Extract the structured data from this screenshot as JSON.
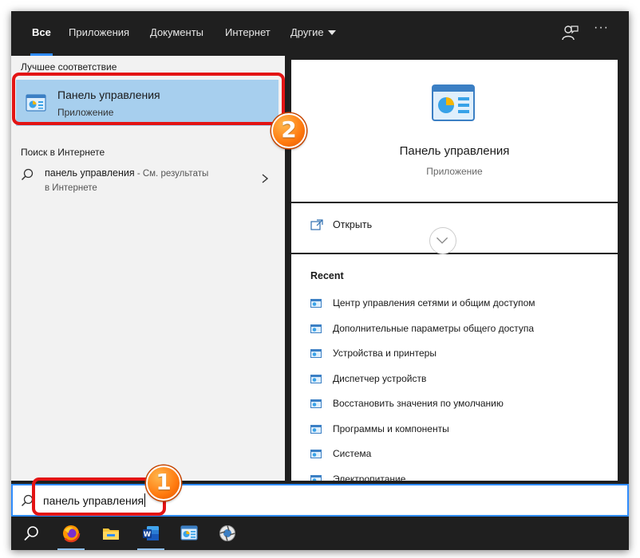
{
  "nav": {
    "tabs": [
      {
        "label": "Все",
        "active": true
      },
      {
        "label": "Приложения"
      },
      {
        "label": "Документы"
      },
      {
        "label": "Интернет"
      },
      {
        "label": "Другие"
      }
    ],
    "feedback_icon": "feedback-icon",
    "more_icon": "more-options-icon",
    "more_glyph": "···"
  },
  "best_match": {
    "heading": "Лучшее соответствие",
    "title": "Панель управления",
    "subtitle": "Приложение",
    "icon": "control-panel-icon"
  },
  "web_search": {
    "heading": "Поиск в Интернете",
    "query": "панель управления",
    "suffix": " - См. результаты",
    "suffix2": "в Интернете",
    "icon": "search-icon"
  },
  "preview": {
    "title": "Панель управления",
    "subtitle": "Приложение",
    "open_label": "Открыть"
  },
  "recent": {
    "heading": "Recent",
    "items": [
      "Центр управления сетями и общим доступом",
      "Дополнительные параметры общего доступа",
      "Устройства и принтеры",
      "Диспетчер устройств",
      "Восстановить значения по умолчанию",
      "Программы и компоненты",
      "Система",
      "Электропитание"
    ]
  },
  "search": {
    "value": "панель управления"
  },
  "taskbar": {
    "items": [
      "search-icon",
      "firefox-icon",
      "file-explorer-icon",
      "word-icon",
      "control-panel-icon",
      "app-icon"
    ]
  },
  "annotations": {
    "badge1": "1",
    "badge2": "2",
    "color": "#e31414"
  },
  "colors": {
    "accent": "#2f8cff",
    "selection": "#a7cfee",
    "dark": "#1f1f1f"
  }
}
